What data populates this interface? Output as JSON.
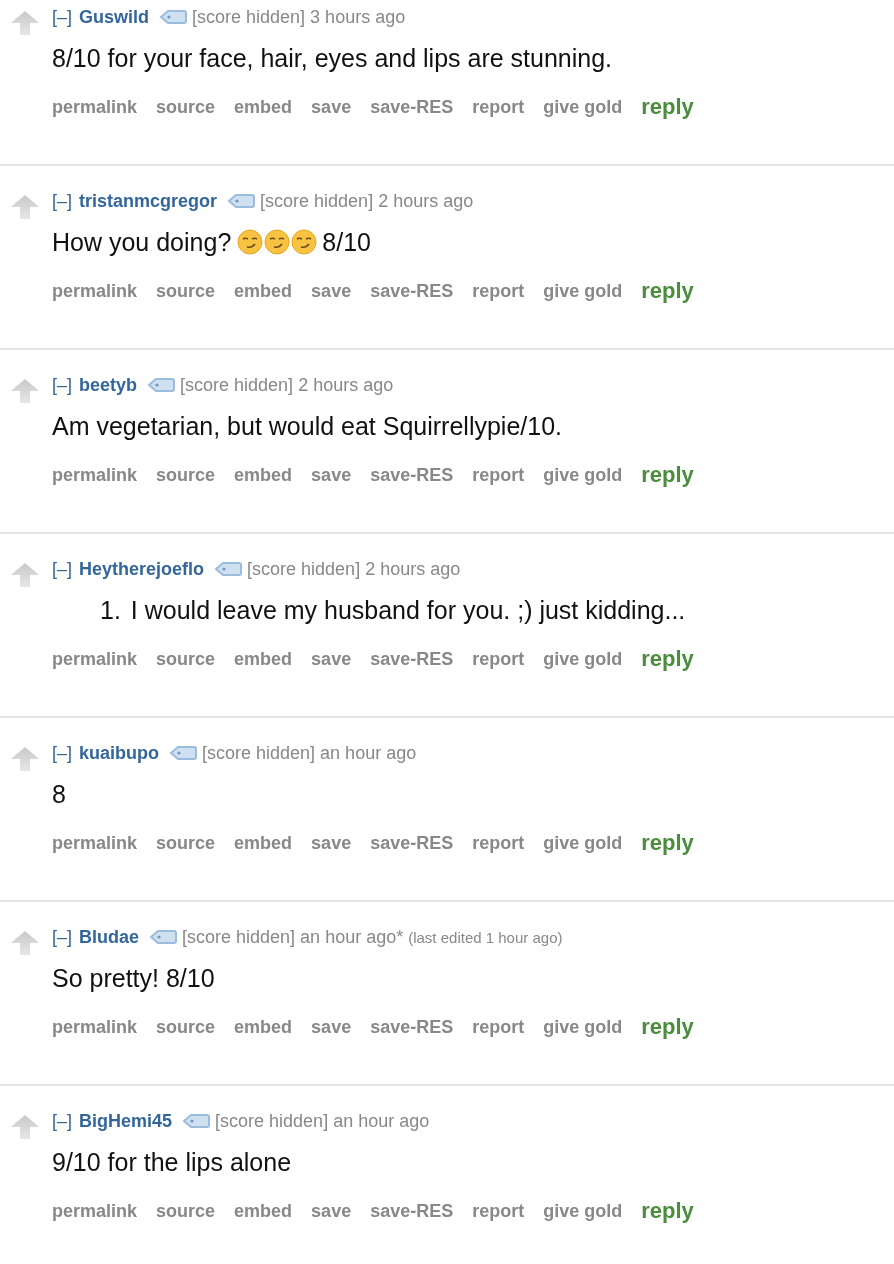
{
  "comments": [
    {
      "collapse": "[–]",
      "author": "Guswild",
      "score": "[score hidden]",
      "time": "3 hours ago",
      "body": [
        {
          "kind": "text",
          "text": "8/10 for your face, hair, eyes and lips are stunning."
        }
      ],
      "actions": [
        {
          "kind": "link",
          "label": "permalink"
        },
        {
          "kind": "link",
          "label": "source"
        },
        {
          "kind": "link",
          "label": "embed"
        },
        {
          "kind": "link",
          "label": "save"
        },
        {
          "kind": "link",
          "label": "save-RES"
        },
        {
          "kind": "link",
          "label": "report"
        },
        {
          "kind": "link",
          "label": "give gold"
        },
        {
          "kind": "reply",
          "label": "reply"
        }
      ]
    },
    {
      "collapse": "[–]",
      "author": "tristanmcgregor",
      "score": "[score hidden]",
      "time": "2 hours ago",
      "body": [
        {
          "kind": "text",
          "text": "How you doing?"
        },
        {
          "kind": "emoji"
        },
        {
          "kind": "emoji"
        },
        {
          "kind": "emoji"
        },
        {
          "kind": "text",
          "text": "8/10"
        }
      ],
      "actions": [
        {
          "kind": "link",
          "label": "permalink"
        },
        {
          "kind": "link",
          "label": "source"
        },
        {
          "kind": "link",
          "label": "embed"
        },
        {
          "kind": "link",
          "label": "save"
        },
        {
          "kind": "link",
          "label": "save-RES"
        },
        {
          "kind": "link",
          "label": "report"
        },
        {
          "kind": "link",
          "label": "give gold"
        },
        {
          "kind": "reply",
          "label": "reply"
        }
      ]
    },
    {
      "collapse": "[–]",
      "author": "beetyb",
      "score": "[score hidden]",
      "time": "2 hours ago",
      "body": [
        {
          "kind": "text",
          "text": "Am vegetarian, but would eat Squirrellypie/10."
        }
      ],
      "actions": [
        {
          "kind": "link",
          "label": "permalink"
        },
        {
          "kind": "link",
          "label": "source"
        },
        {
          "kind": "link",
          "label": "embed"
        },
        {
          "kind": "link",
          "label": "save"
        },
        {
          "kind": "link",
          "label": "save-RES"
        },
        {
          "kind": "link",
          "label": "report"
        },
        {
          "kind": "link",
          "label": "give gold"
        },
        {
          "kind": "reply",
          "label": "reply"
        }
      ]
    },
    {
      "collapse": "[–]",
      "author": "Heytherejoeflo",
      "score": "[score hidden]",
      "time": "2 hours ago",
      "body": [
        {
          "kind": "list_number",
          "text": "1."
        },
        {
          "kind": "text",
          "text": "I would leave my husband for you. ;) just kidding..."
        }
      ],
      "actions": [
        {
          "kind": "link",
          "label": "permalink"
        },
        {
          "kind": "link",
          "label": "source"
        },
        {
          "kind": "link",
          "label": "embed"
        },
        {
          "kind": "link",
          "label": "save"
        },
        {
          "kind": "link",
          "label": "save-RES"
        },
        {
          "kind": "link",
          "label": "report"
        },
        {
          "kind": "link",
          "label": "give gold"
        },
        {
          "kind": "reply",
          "label": "reply"
        }
      ]
    },
    {
      "collapse": "[–]",
      "author": "kuaibupo",
      "score": "[score hidden]",
      "time": "an hour ago",
      "body": [
        {
          "kind": "text",
          "text": "8"
        }
      ],
      "actions": [
        {
          "kind": "link",
          "label": "permalink"
        },
        {
          "kind": "link",
          "label": "source"
        },
        {
          "kind": "link",
          "label": "embed"
        },
        {
          "kind": "link",
          "label": "save"
        },
        {
          "kind": "link",
          "label": "save-RES"
        },
        {
          "kind": "link",
          "label": "report"
        },
        {
          "kind": "link",
          "label": "give gold"
        },
        {
          "kind": "reply",
          "label": "reply"
        }
      ]
    },
    {
      "collapse": "[–]",
      "author": "Bludae",
      "score": "[score hidden]",
      "time": "an hour ago*",
      "edited": "(last edited 1 hour ago)",
      "body": [
        {
          "kind": "text",
          "text": "So pretty! 8/10"
        }
      ],
      "actions": [
        {
          "kind": "link",
          "label": "permalink"
        },
        {
          "kind": "link",
          "label": "source"
        },
        {
          "kind": "link",
          "label": "embed"
        },
        {
          "kind": "link",
          "label": "save"
        },
        {
          "kind": "link",
          "label": "save-RES"
        },
        {
          "kind": "link",
          "label": "report"
        },
        {
          "kind": "link",
          "label": "give gold"
        },
        {
          "kind": "reply",
          "label": "reply"
        }
      ]
    },
    {
      "collapse": "[–]",
      "author": "BigHemi45",
      "score": "[score hidden]",
      "time": "an hour ago",
      "body": [
        {
          "kind": "text",
          "text": "9/10 for the lips alone"
        }
      ],
      "actions": [
        {
          "kind": "link",
          "label": "permalink"
        },
        {
          "kind": "link",
          "label": "source"
        },
        {
          "kind": "link",
          "label": "embed"
        },
        {
          "kind": "link",
          "label": "save"
        },
        {
          "kind": "link",
          "label": "save-RES"
        },
        {
          "kind": "link",
          "label": "report"
        },
        {
          "kind": "link",
          "label": "give gold"
        },
        {
          "kind": "reply",
          "label": "reply"
        }
      ]
    }
  ]
}
